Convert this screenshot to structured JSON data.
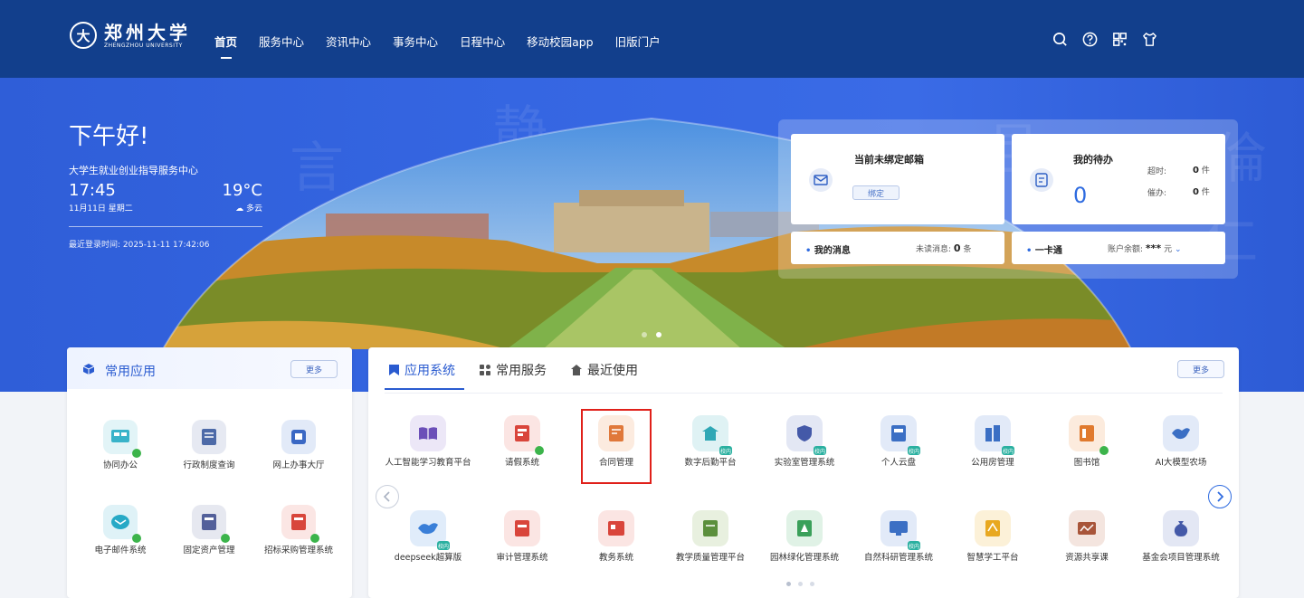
{
  "nav": {
    "logo_cn": "郑州大学",
    "logo_en": "ZHENGZHOU UNIVERSITY",
    "items": [
      {
        "label": "首页",
        "active": true
      },
      {
        "label": "服务中心"
      },
      {
        "label": "资讯中心"
      },
      {
        "label": "事务中心"
      },
      {
        "label": "日程中心"
      },
      {
        "label": "移动校园app"
      },
      {
        "label": "旧版门户"
      }
    ],
    "tools": [
      "search-icon",
      "help-icon",
      "qrcode-icon",
      "shirt-icon"
    ]
  },
  "hero": {
    "greeting": "下午好!",
    "department": "大学生就业创业指导服务中心",
    "time": "17:45",
    "date": "11月11日 星期二",
    "temperature": "19°C",
    "weather": "多云",
    "last_login": "最近登录时间: 2025-11-11 17:42:06"
  },
  "mail_card": {
    "title": "当前未绑定邮箱",
    "button": "绑定"
  },
  "todo_card": {
    "title": "我的待办",
    "count": "0",
    "overdue_label": "超时:",
    "overdue_value": "0",
    "overdue_unit": "件",
    "urge_label": "催办:",
    "urge_value": "0",
    "urge_unit": "件"
  },
  "message_bar": {
    "label": "我的消息",
    "unread_label": "未读消息:",
    "unread_value": "0",
    "unread_unit": "条"
  },
  "card_bar": {
    "label": "一卡通",
    "balance_label": "账户余额:",
    "balance_value": "***",
    "balance_unit": "元"
  },
  "common_apps": {
    "title": "常用应用",
    "more": "更多",
    "items": [
      {
        "label": "协同办公",
        "color": "#39b3c9"
      },
      {
        "label": "行政制度查询",
        "color": "#4d6aa8"
      },
      {
        "label": "网上办事大厅",
        "color": "#3a68c4"
      },
      {
        "label": "电子邮件系统",
        "color": "#27a9c6"
      },
      {
        "label": "固定资产管理",
        "color": "#53609a"
      },
      {
        "label": "招标采购管理系统",
        "color": "#d8463b"
      }
    ]
  },
  "systems": {
    "tabs": [
      {
        "label": "应用系统",
        "active": true
      },
      {
        "label": "常用服务"
      },
      {
        "label": "最近使用"
      }
    ],
    "more": "更多",
    "tag_text": "校内",
    "items": [
      {
        "label": "人工智能学习教育平台",
        "color": "#6b4fb8"
      },
      {
        "label": "请假系统",
        "color": "#d9453b"
      },
      {
        "label": "合同管理",
        "color": "#e0783a"
      },
      {
        "label": "数字后勤平台",
        "color": "#2fa7b5"
      },
      {
        "label": "实验室管理系统",
        "color": "#4459a8"
      },
      {
        "label": "个人云盘",
        "color": "#3b6fc4"
      },
      {
        "label": "公用房管理",
        "color": "#3b6fc4"
      },
      {
        "label": "图书馆",
        "color": "#e07a2e"
      },
      {
        "label": "AI大模型农场",
        "color": "#3b6fc4"
      },
      {
        "label": "deepseek超算版",
        "color": "#3a7fd8"
      },
      {
        "label": "审计管理系统",
        "color": "#d9453b"
      },
      {
        "label": "教务系统",
        "color": "#d9453b"
      },
      {
        "label": "教学质量管理平台",
        "color": "#5b8f3c"
      },
      {
        "label": "园林绿化管理系统",
        "color": "#3aa05a"
      },
      {
        "label": "自然科研管理系统",
        "color": "#3b6fc4"
      },
      {
        "label": "智慧学工平台",
        "color": "#e8a820"
      },
      {
        "label": "资源共享课",
        "color": "#a8553a"
      },
      {
        "label": "基金会项目管理系统",
        "color": "#4459a8"
      }
    ]
  }
}
